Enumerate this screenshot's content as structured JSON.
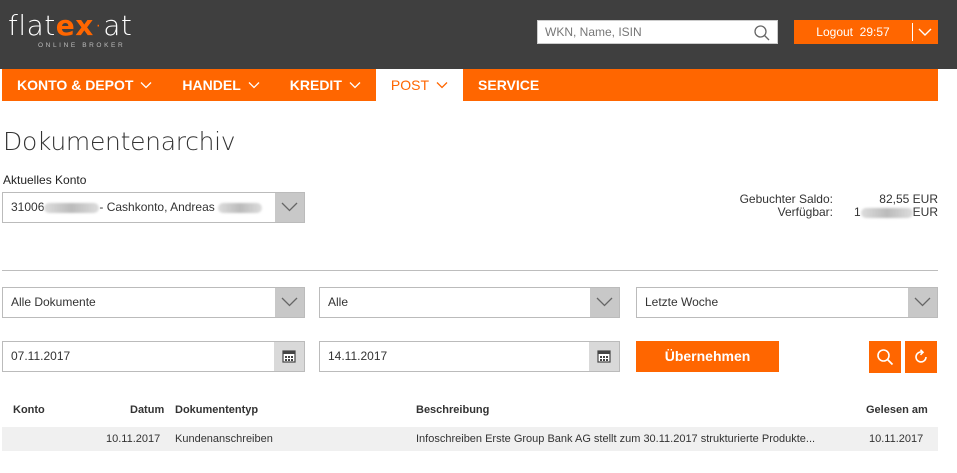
{
  "header": {
    "logo": {
      "name_left": "flat",
      "name_accent": "ex",
      "name_dot": "·",
      "name_right": "at",
      "tagline": "ONLINE BROKER"
    },
    "search": {
      "placeholder": "WKN, Name, ISIN",
      "icon": "search-icon"
    },
    "logout": {
      "label": "Logout",
      "timer": "29:57",
      "icon": "chevron-down-icon"
    }
  },
  "nav": {
    "items": [
      {
        "label": "KONTO & DEPOT",
        "has_dropdown": true,
        "active": false
      },
      {
        "label": "HANDEL",
        "has_dropdown": true,
        "active": false
      },
      {
        "label": "KREDIT",
        "has_dropdown": true,
        "active": false
      },
      {
        "label": "POST",
        "has_dropdown": true,
        "active": true
      },
      {
        "label": "SERVICE",
        "has_dropdown": false,
        "active": false
      }
    ]
  },
  "page": {
    "title": "Dokumentenarchiv",
    "konto_label": "Aktuelles Konto",
    "konto_select": {
      "prefix": "31006",
      "middle": "- Cashkonto, Andreas"
    },
    "balance": {
      "booked_label": "Gebuchter Saldo:",
      "booked_value": "82,55 EUR",
      "available_label": "Verfügbar:",
      "available_prefix": "1",
      "available_suffix": "EUR"
    }
  },
  "filters": {
    "document_type": "Alle Dokumente",
    "status": "Alle",
    "period": "Letzte Woche",
    "date_from": "07.11.2017",
    "date_to": "14.11.2017",
    "apply_label": "Übernehmen"
  },
  "table": {
    "headers": [
      "Konto",
      "Datum",
      "Dokumententyp",
      "Beschreibung",
      "Gelesen am"
    ],
    "rows": [
      {
        "konto": "",
        "datum": "10.11.2017",
        "typ": "Kundenanschreiben",
        "beschreibung": "Infoschreiben Erste Group Bank AG stellt zum 30.11.2017 strukturierte Produkte...",
        "gelesen": "10.11.2017"
      }
    ]
  },
  "colors": {
    "brand": "#ff6600",
    "header_bg": "#3f3f3f",
    "row_bg": "#f0f0f0"
  }
}
